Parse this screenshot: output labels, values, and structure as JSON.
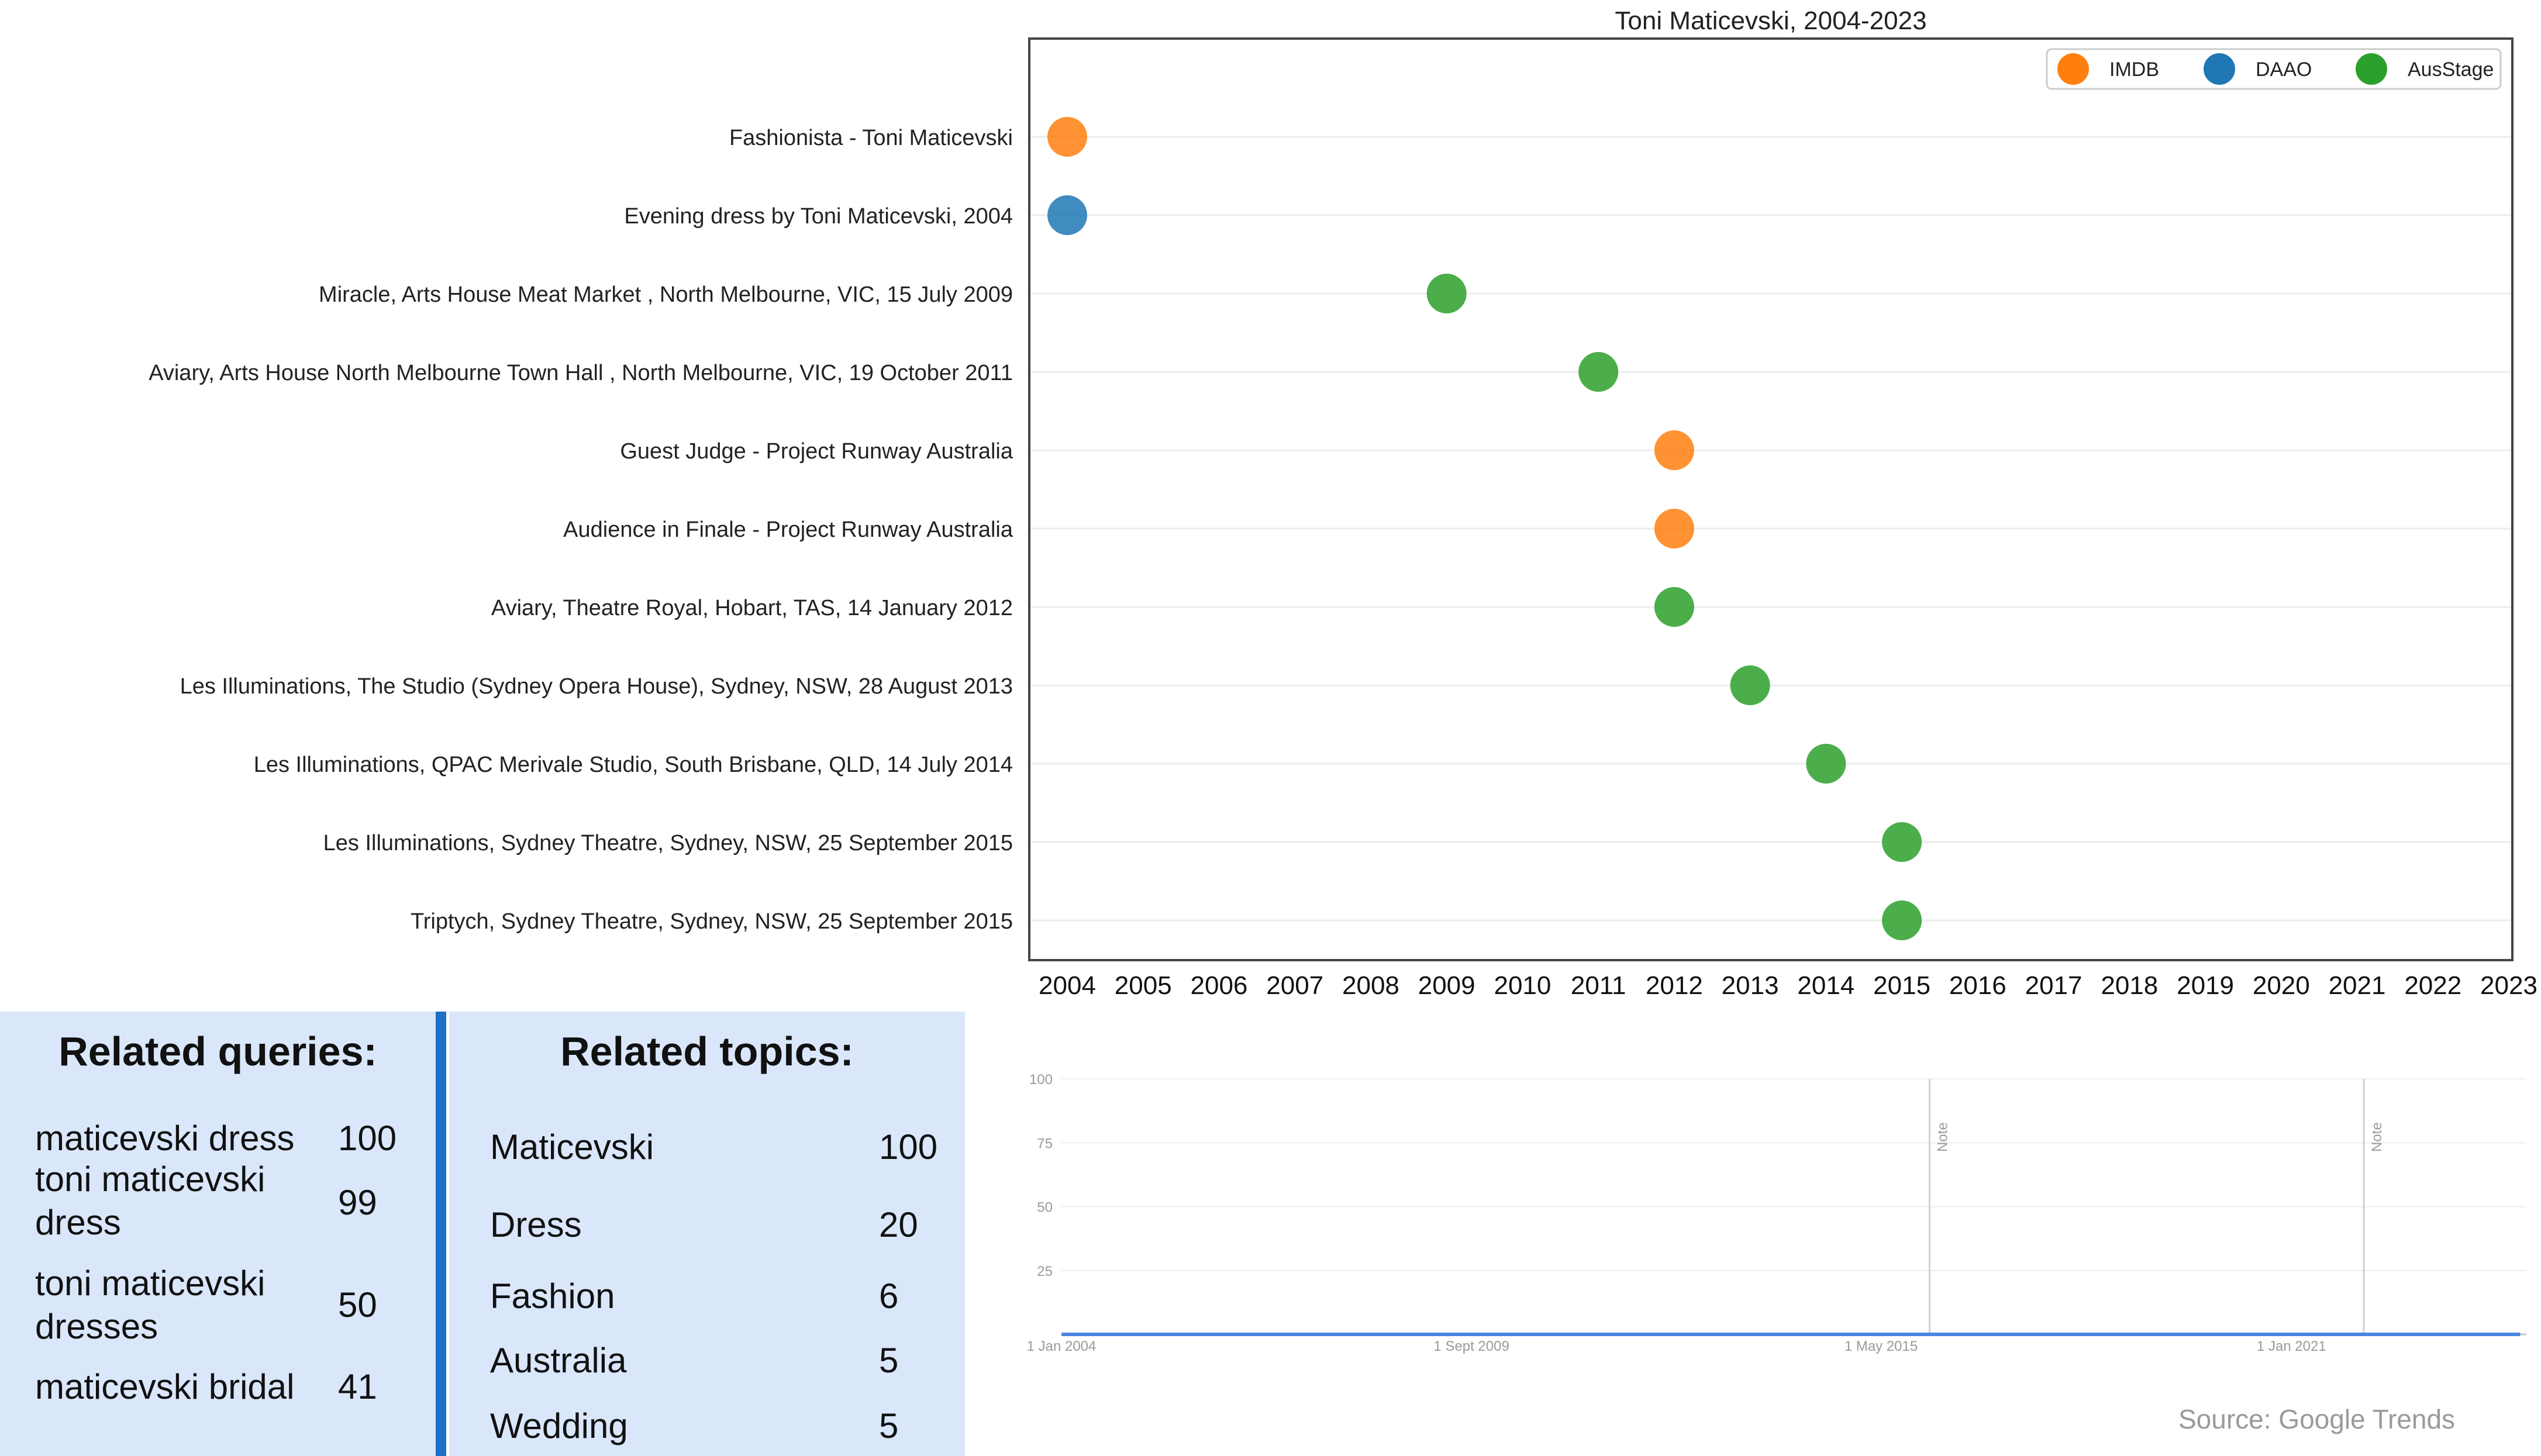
{
  "chart_data": [
    {
      "type": "scatter",
      "title": "Toni Maticevski, 2004-2023",
      "x_ticks": [
        "2004",
        "2005",
        "2006",
        "2007",
        "2008",
        "2009",
        "2010",
        "2011",
        "2012",
        "2013",
        "2014",
        "2015",
        "2016",
        "2017",
        "2018",
        "2019",
        "2020",
        "2021",
        "2022",
        "2023"
      ],
      "xlim": [
        2004,
        2023
      ],
      "categories": [
        "Fashionista - Toni Maticevski",
        "Evening dress by Toni Maticevski, 2004",
        "Miracle, Arts House Meat Market , North Melbourne, VIC, 15 July 2009",
        "Aviary, Arts House North Melbourne Town Hall , North Melbourne, VIC, 19 October 2011",
        "Guest Judge - Project Runway Australia",
        "Audience in Finale - Project Runway Australia",
        "Aviary, Theatre Royal, Hobart, TAS, 14 January 2012",
        "Les Illuminations, The Studio (Sydney Opera House), Sydney, NSW, 28 August 2013",
        "Les Illuminations, QPAC Merivale Studio, South Brisbane, QLD, 14 July 2014",
        "Les Illuminations, Sydney Theatre, Sydney, NSW, 25 September 2015",
        "Triptych, Sydney Theatre, Sydney, NSW, 25 September 2015"
      ],
      "series": [
        {
          "name": "IMDB",
          "color": "#ff7f0e",
          "points": [
            {
              "label_index": 0,
              "x": 2004
            },
            {
              "label_index": 4,
              "x": 2012
            },
            {
              "label_index": 5,
              "x": 2012
            }
          ]
        },
        {
          "name": "DAAO",
          "color": "#1f77b4",
          "points": [
            {
              "label_index": 1,
              "x": 2004
            }
          ]
        },
        {
          "name": "AusStage",
          "color": "#2ca02c",
          "points": [
            {
              "label_index": 2,
              "x": 2009
            },
            {
              "label_index": 3,
              "x": 2011
            },
            {
              "label_index": 6,
              "x": 2012
            },
            {
              "label_index": 7,
              "x": 2013
            },
            {
              "label_index": 8,
              "x": 2014
            },
            {
              "label_index": 9,
              "x": 2015
            },
            {
              "label_index": 10,
              "x": 2015
            }
          ]
        }
      ],
      "legend": "top-right",
      "grid": "horizontal"
    },
    {
      "type": "line",
      "title": "",
      "color": "#4a86e0",
      "ylim": [
        0,
        100
      ],
      "y_ticks": [
        25,
        50,
        75,
        100
      ],
      "x_ticks": [
        {
          "date": "2004-01-01",
          "label": "1 Jan 2004"
        },
        {
          "date": "2009-09-01",
          "label": "1 Sept 2009"
        },
        {
          "date": "2015-05-01",
          "label": "1 May 2015"
        },
        {
          "date": "2021-01-01",
          "label": "1 Jan 2021"
        }
      ],
      "x_range": [
        "2004-01-01",
        "2024-04-01"
      ],
      "notes": [
        {
          "date": "2016-01-01",
          "label": "Note"
        },
        {
          "date": "2022-01-01",
          "label": "Note"
        }
      ],
      "x": [
        "2004-01",
        "2004-02",
        "2004-03",
        "2004-04",
        "2004-05",
        "2004-06",
        "2004-07",
        "2004-08",
        "2004-09",
        "2004-10",
        "2004-11",
        "2004-12",
        "2005-01",
        "2005-02",
        "2005-03",
        "2005-04",
        "2005-05",
        "2005-06",
        "2005-07",
        "2005-08",
        "2005-09",
        "2005-10",
        "2005-11",
        "2005-12",
        "2006-01",
        "2006-02",
        "2006-03",
        "2006-04",
        "2006-05",
        "2006-06",
        "2006-07",
        "2006-08",
        "2006-09",
        "2006-10",
        "2006-11",
        "2006-12",
        "2007-01",
        "2007-02",
        "2007-03",
        "2007-04",
        "2007-05",
        "2007-06",
        "2007-07",
        "2007-08",
        "2007-09",
        "2007-10",
        "2007-11",
        "2007-12",
        "2008-01",
        "2008-02",
        "2008-03",
        "2008-04",
        "2008-05",
        "2008-06",
        "2008-07",
        "2008-08",
        "2008-09",
        "2008-10",
        "2008-11",
        "2008-12",
        "2009-01",
        "2009-02",
        "2009-03",
        "2009-04",
        "2009-05",
        "2009-06",
        "2009-07",
        "2009-08",
        "2009-09",
        "2009-10",
        "2009-11",
        "2009-12",
        "2010-01",
        "2010-02",
        "2010-03",
        "2010-04",
        "2010-05",
        "2010-06",
        "2010-07",
        "2010-08",
        "2010-09",
        "2010-10",
        "2010-11",
        "2010-12",
        "2011-01",
        "2011-02",
        "2011-03",
        "2011-04",
        "2011-05",
        "2011-06",
        "2011-07",
        "2011-08",
        "2011-09",
        "2011-10",
        "2011-11",
        "2011-12",
        "2012-01",
        "2012-02",
        "2012-03",
        "2012-04",
        "2012-05",
        "2012-06",
        "2012-07",
        "2012-08",
        "2012-09",
        "2012-10",
        "2012-11",
        "2012-12",
        "2013-01",
        "2013-02",
        "2013-03",
        "2013-04",
        "2013-05",
        "2013-06",
        "2013-07",
        "2013-08",
        "2013-09",
        "2013-10",
        "2013-11",
        "2013-12",
        "2014-01",
        "2014-02",
        "2014-03",
        "2014-04",
        "2014-05",
        "2014-06",
        "2014-07",
        "2014-08",
        "2014-09",
        "2014-10",
        "2014-11",
        "2014-12",
        "2015-01",
        "2015-02",
        "2015-03",
        "2015-04",
        "2015-05",
        "2015-06",
        "2015-07",
        "2015-08",
        "2015-09",
        "2015-10",
        "2015-11",
        "2015-12",
        "2016-01",
        "2016-02",
        "2016-03",
        "2016-04",
        "2016-05",
        "2016-06",
        "2016-07",
        "2016-08",
        "2016-09",
        "2016-10",
        "2016-11",
        "2016-12",
        "2017-01",
        "2017-02",
        "2017-03",
        "2017-04",
        "2017-05",
        "2017-06",
        "2017-07",
        "2017-08",
        "2017-09",
        "2017-10",
        "2017-11",
        "2017-12",
        "2018-01",
        "2018-02",
        "2018-03",
        "2018-04",
        "2018-05",
        "2018-06",
        "2018-07",
        "2018-08",
        "2018-09",
        "2018-10",
        "2018-11",
        "2018-12",
        "2019-01",
        "2019-02",
        "2019-03",
        "2019-04",
        "2019-05",
        "2019-06",
        "2019-07",
        "2019-08",
        "2019-09",
        "2019-10",
        "2019-11",
        "2019-12",
        "2020-01",
        "2020-02",
        "2020-03",
        "2020-04",
        "2020-05",
        "2020-06",
        "2020-07",
        "2020-08",
        "2020-09",
        "2020-10",
        "2020-11",
        "2020-12",
        "2021-01",
        "2021-02",
        "2021-03",
        "2021-04",
        "2021-05",
        "2021-06",
        "2021-07",
        "2021-08",
        "2021-09",
        "2021-10",
        "2021-11",
        "2021-12",
        "2022-01",
        "2022-02",
        "2022-03",
        "2022-04",
        "2022-05",
        "2022-06",
        "2022-07",
        "2022-08",
        "2022-09",
        "2022-10",
        "2022-11",
        "2022-12",
        "2023-01",
        "2023-02",
        "2023-03",
        "2023-04",
        "2023-05",
        "2023-06",
        "2023-07",
        "2023-08",
        "2023-09",
        "2023-10",
        "2023-11",
        "2023-12",
        "2024-01",
        "2024-02",
        "2024-03"
      ],
      "values": [
        0,
        0,
        0,
        0,
        0,
        0,
        0,
        0,
        0,
        0,
        0,
        0,
        0,
        0,
        0,
        0,
        0,
        0,
        0,
        0,
        0,
        0,
        0,
        0,
        0,
        0,
        0,
        0,
        0,
        0,
        0,
        0,
        0,
        0,
        0,
        0,
        0,
        0,
        0,
        0,
        0,
        0,
        0,
        0,
        0,
        0,
        0,
        0,
        0,
        0,
        0,
        0,
        0,
        0,
        0,
        0,
        0,
        0,
        0,
        0,
        0,
        0,
        0,
        0,
        0,
        0,
        0,
        0,
        0,
        0,
        0,
        0,
        0,
        0,
        0,
        0,
        0,
        0,
        0,
        0,
        0,
        0,
        0,
        0,
        0,
        0,
        0,
        0,
        0,
        0,
        0,
        0,
        0,
        0,
        0,
        0,
        0,
        0,
        0,
        0,
        0,
        0,
        0,
        0,
        0,
        0,
        0,
        0,
        0,
        0,
        0,
        0,
        0,
        0,
        0,
        0,
        0,
        0,
        0,
        0,
        0,
        0,
        0,
        0,
        0,
        0,
        0,
        0,
        0,
        0,
        0,
        0,
        0,
        0,
        0,
        0,
        0,
        0,
        0,
        0,
        0,
        0,
        0,
        0,
        0,
        0,
        0,
        0,
        0,
        0,
        0,
        0,
        0,
        0,
        0,
        0,
        0,
        0,
        0,
        0,
        0,
        0,
        0,
        0,
        0,
        0,
        0,
        0,
        0,
        0,
        0,
        0,
        0,
        0,
        0,
        0,
        0,
        0,
        0,
        0,
        0,
        0,
        0,
        0,
        0,
        0,
        0,
        0,
        0,
        0,
        0,
        0,
        0,
        0,
        0,
        0,
        0,
        0,
        0,
        0,
        0,
        0,
        0,
        0,
        0,
        0,
        0,
        0,
        0,
        0,
        0,
        0,
        0,
        0,
        0,
        0,
        0,
        0,
        0,
        0,
        0,
        0,
        0,
        0,
        0,
        0,
        0,
        0,
        0,
        0,
        0,
        0,
        0,
        0,
        0,
        0,
        0,
        0,
        0,
        0,
        0,
        0,
        0,
        0,
        0,
        0
      ]
    }
  ],
  "related_queries": {
    "title": "Related queries:",
    "items": [
      {
        "lines": [
          "maticevski dress"
        ],
        "value": "100"
      },
      {
        "lines": [
          "toni maticevski",
          "dress"
        ],
        "value": "99"
      },
      {
        "lines": [
          "toni maticevski",
          "dresses"
        ],
        "value": "50"
      },
      {
        "lines": [
          "maticevski bridal"
        ],
        "value": "41"
      }
    ]
  },
  "related_topics": {
    "title": "Related topics:",
    "items": [
      {
        "label": "Maticevski",
        "value": "100"
      },
      {
        "label": "Dress",
        "value": "20"
      },
      {
        "label": "Fashion",
        "value": "6"
      },
      {
        "label": "Australia",
        "value": "5"
      },
      {
        "label": "Wedding",
        "value": "5"
      }
    ]
  },
  "source": "Source: Google Trends"
}
